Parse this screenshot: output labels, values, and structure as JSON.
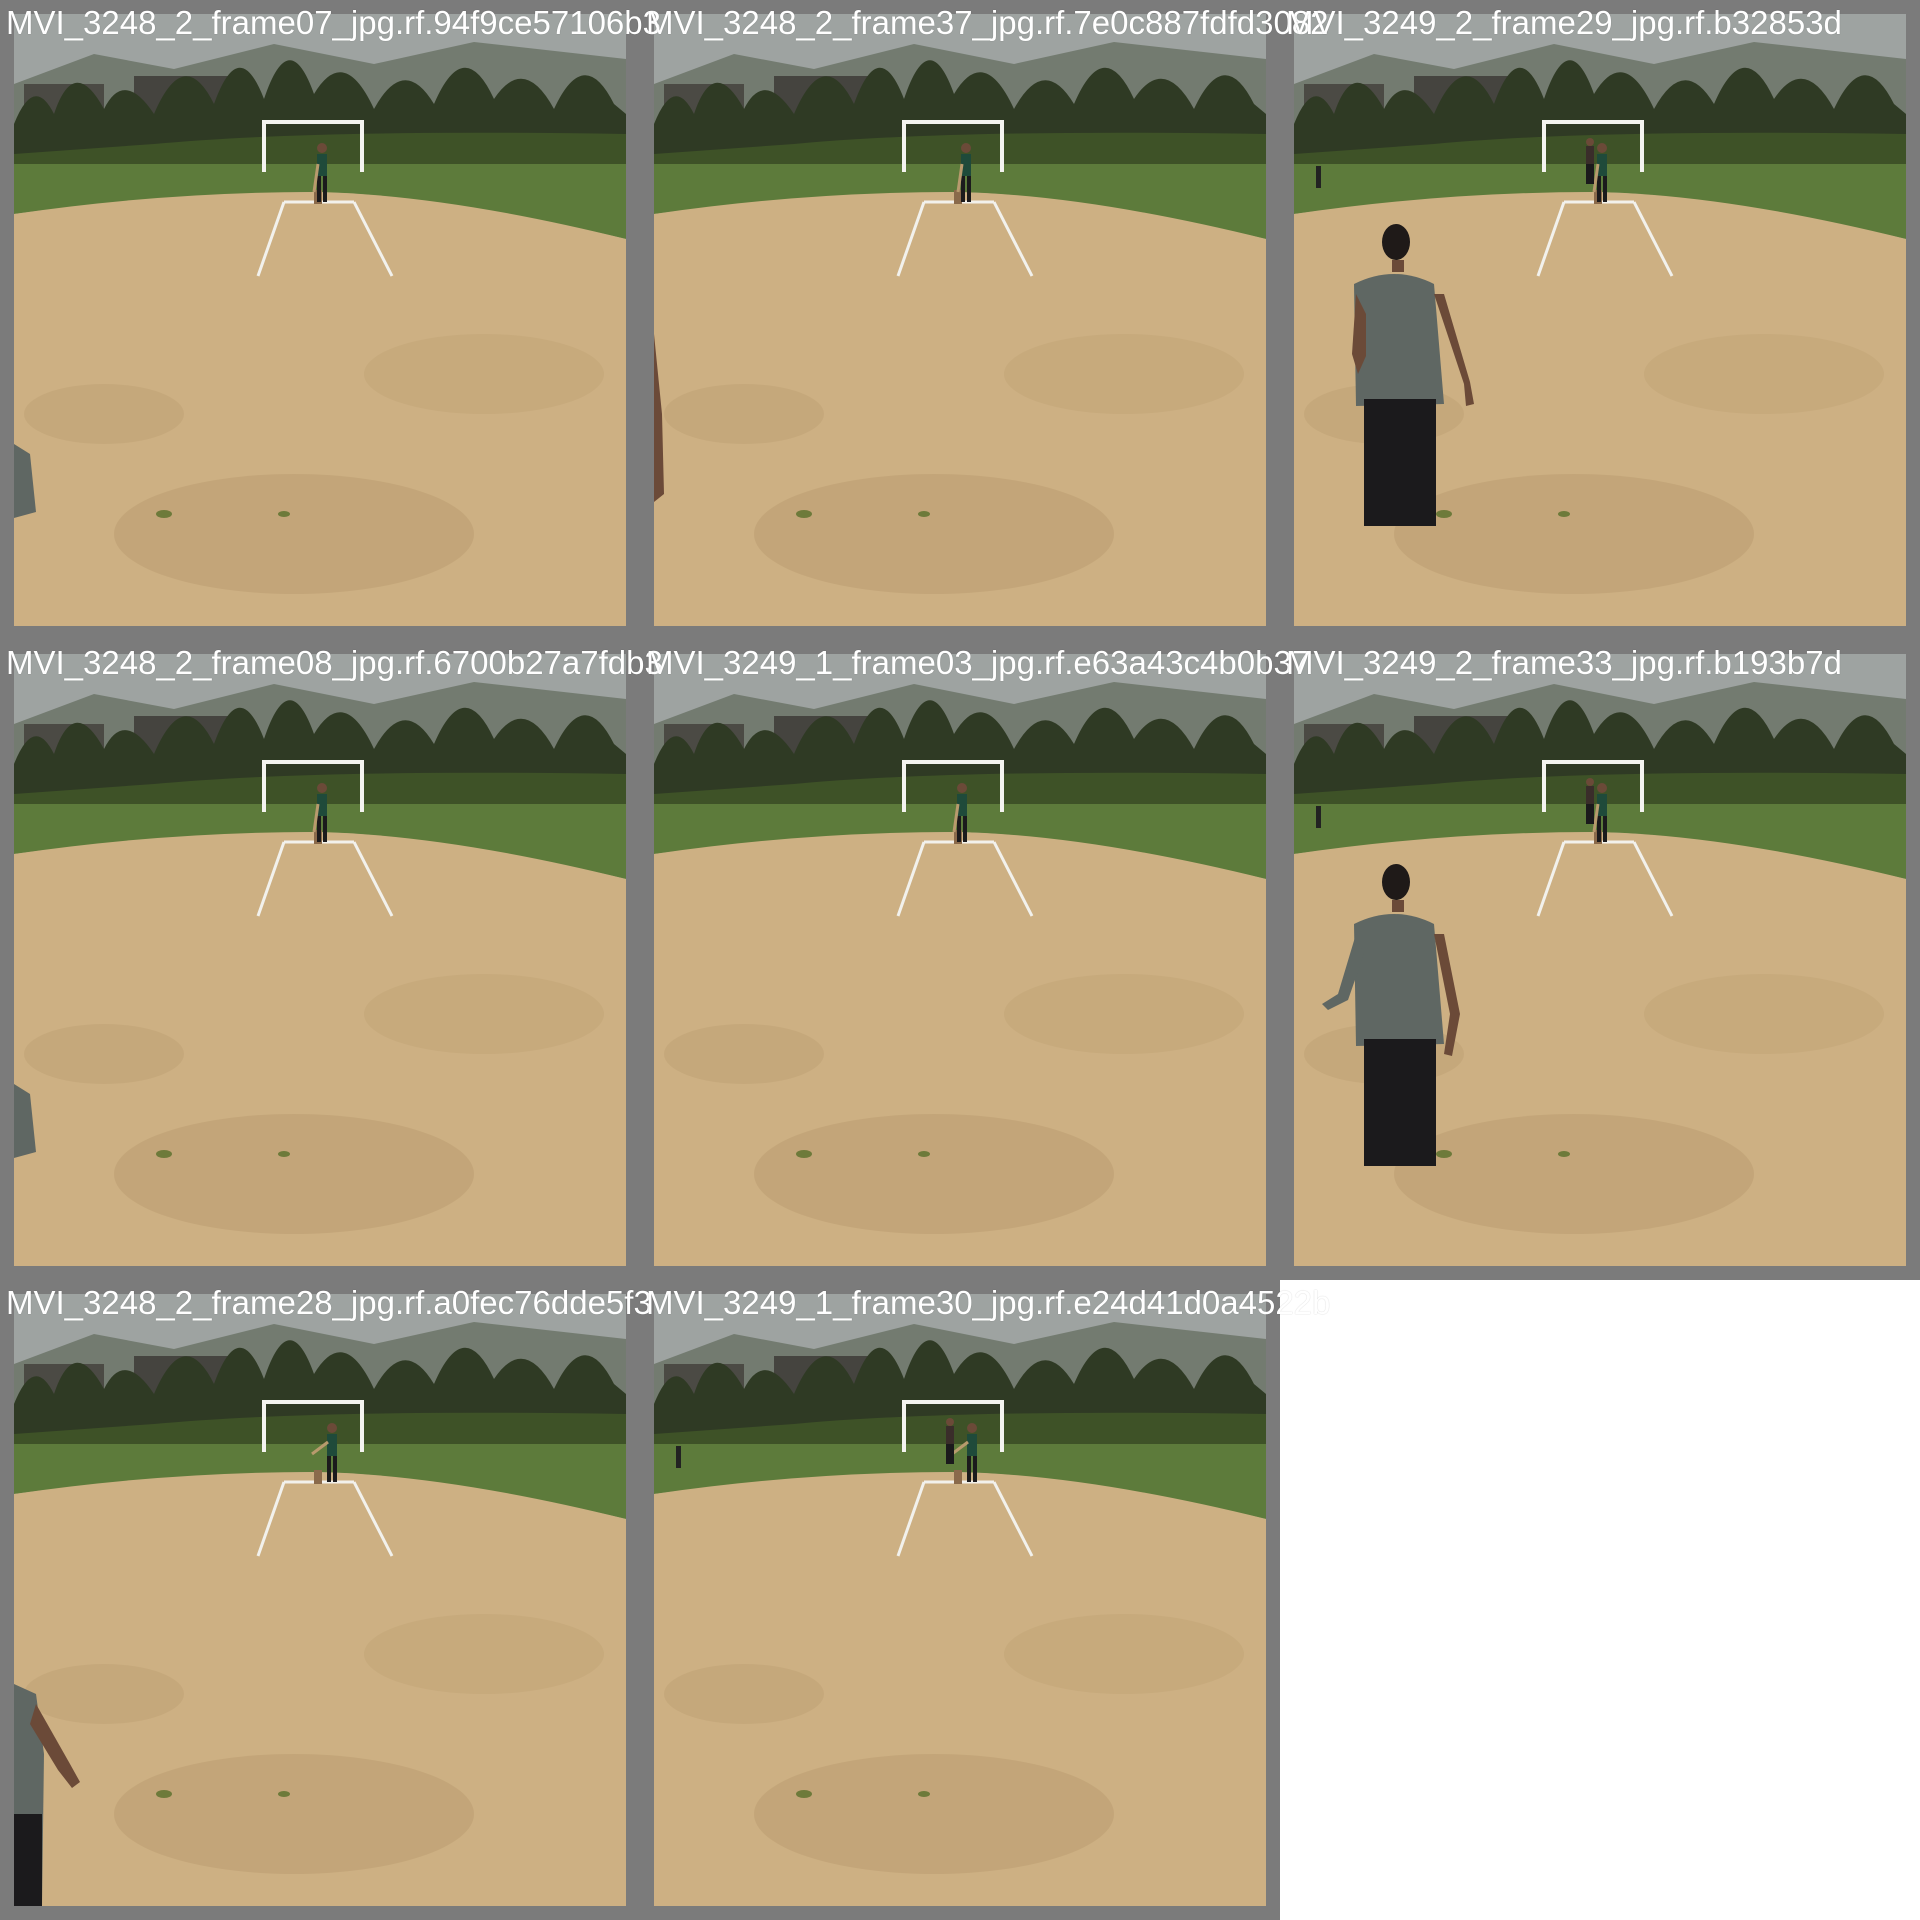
{
  "mosaic": {
    "background_color": "#ffffff",
    "border_color": "#7b7b7b",
    "caption_color": "#ffffff",
    "tiles": [
      {
        "caption": "MVI_3248_2_frame07_jpg.rf.94f9ce57106b3",
        "scene": {
          "near_figure": "left-edge-small",
          "batter_pose": "stance",
          "far_figure": false
        }
      },
      {
        "caption": "MVI_3248_2_frame37_jpg.rf.7e0c887fdfd3082",
        "scene": {
          "near_figure": "left-edge-sliver",
          "batter_pose": "stride",
          "far_figure": false
        }
      },
      {
        "caption": "MVI_3249_2_frame29_jpg.rf.b32853d",
        "scene": {
          "near_figure": "bowler-large",
          "batter_pose": "stance",
          "far_figure": true
        }
      },
      {
        "caption": "MVI_3248_2_frame08_jpg.rf.6700b27a7fdb3",
        "scene": {
          "near_figure": "left-edge-small",
          "batter_pose": "stance",
          "far_figure": false
        }
      },
      {
        "caption": "MVI_3249_1_frame03_jpg.rf.e63a43c4b0b37",
        "scene": {
          "near_figure": "none",
          "batter_pose": "stance",
          "far_figure": false
        }
      },
      {
        "caption": "MVI_3249_2_frame33_jpg.rf.b193b7d",
        "scene": {
          "near_figure": "bowler-large-arm-out",
          "batter_pose": "stance",
          "far_figure": true
        }
      },
      {
        "caption": "MVI_3248_2_frame28_jpg.rf.a0fec76dde5f3",
        "scene": {
          "near_figure": "left-edge-arm",
          "batter_pose": "swing",
          "far_figure": false
        }
      },
      {
        "caption": "MVI_3249_1_frame30_jpg.rf.e24d41d0a4522b",
        "scene": {
          "near_figure": "none",
          "batter_pose": "swing",
          "far_figure": true
        }
      }
    ]
  },
  "palette": {
    "sky": "#9ea3a1",
    "hills": "#6b7467",
    "treeline": "#2f3a24",
    "grass": "#5d7b3b",
    "grass_light": "#6f8d45",
    "pitch_sand": "#cdb083",
    "pitch_shadow": "#b89a6d",
    "crease_white": "#f2f1ec",
    "goal_white": "#f4f4f0",
    "shirt_grey": "#5f6763",
    "trousers": "#1b1a1c",
    "skin": "#6b4a38",
    "batter_shirt": "#1f4a3a"
  }
}
